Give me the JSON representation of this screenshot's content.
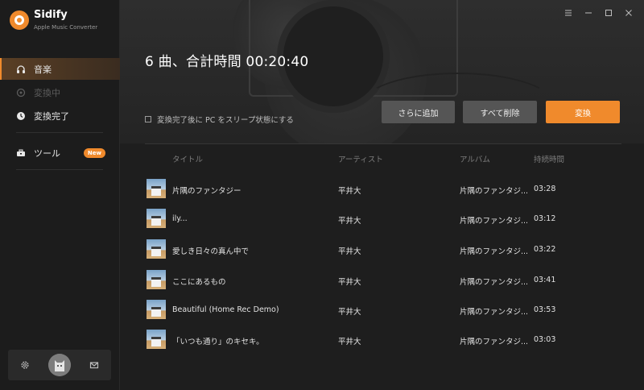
{
  "app": {
    "name": "Sidify",
    "subtitle": "Apple Music Converter"
  },
  "sidebar": {
    "items": [
      {
        "label": "音楽",
        "icon": "headphones-icon",
        "state": "active"
      },
      {
        "label": "変換中",
        "icon": "converting-icon",
        "state": "disabled"
      },
      {
        "label": "変換完了",
        "icon": "clock-icon",
        "state": "normal"
      }
    ],
    "tools": {
      "label": "ツール",
      "badge": "New"
    },
    "bottom": {
      "settings_icon": "gear-icon",
      "avatar_icon": "avatar",
      "mail_icon": "mail-icon"
    }
  },
  "window": {
    "controls": [
      "menu-icon",
      "minimize-icon",
      "maximize-icon",
      "close-icon"
    ]
  },
  "header": {
    "summary": "6 曲、合計時間 00:20:40",
    "sleep_option": "変換完了後に PC をスリープ状態にする",
    "buttons": {
      "add": "さらに追加",
      "delete_all": "すべて削除",
      "convert": "変換"
    }
  },
  "table": {
    "columns": [
      "タイトル",
      "アーティスト",
      "アルバム",
      "持続時間"
    ],
    "rows": [
      {
        "title": "片隅のファンタジー",
        "artist": "平井大",
        "album": "片隅のファンタジ...",
        "duration": "03:28"
      },
      {
        "title": "ily...",
        "artist": "平井大",
        "album": "片隅のファンタジ...",
        "duration": "03:12"
      },
      {
        "title": "愛しき日々の真ん中で",
        "artist": "平井大",
        "album": "片隅のファンタジ...",
        "duration": "03:22"
      },
      {
        "title": "ここにあるもの",
        "artist": "平井大",
        "album": "片隅のファンタジ...",
        "duration": "03:41"
      },
      {
        "title": "Beautiful (Home Rec Demo)",
        "artist": "平井大",
        "album": "片隅のファンタジ...",
        "duration": "03:53"
      },
      {
        "title": "「いつも通り」のキセキ。",
        "artist": "平井大",
        "album": "片隅のファンタジ...",
        "duration": "03:03"
      }
    ]
  },
  "colors": {
    "accent": "#f08a2c",
    "background": "#1e1e1e",
    "sidebar": "#1c1c1c"
  }
}
